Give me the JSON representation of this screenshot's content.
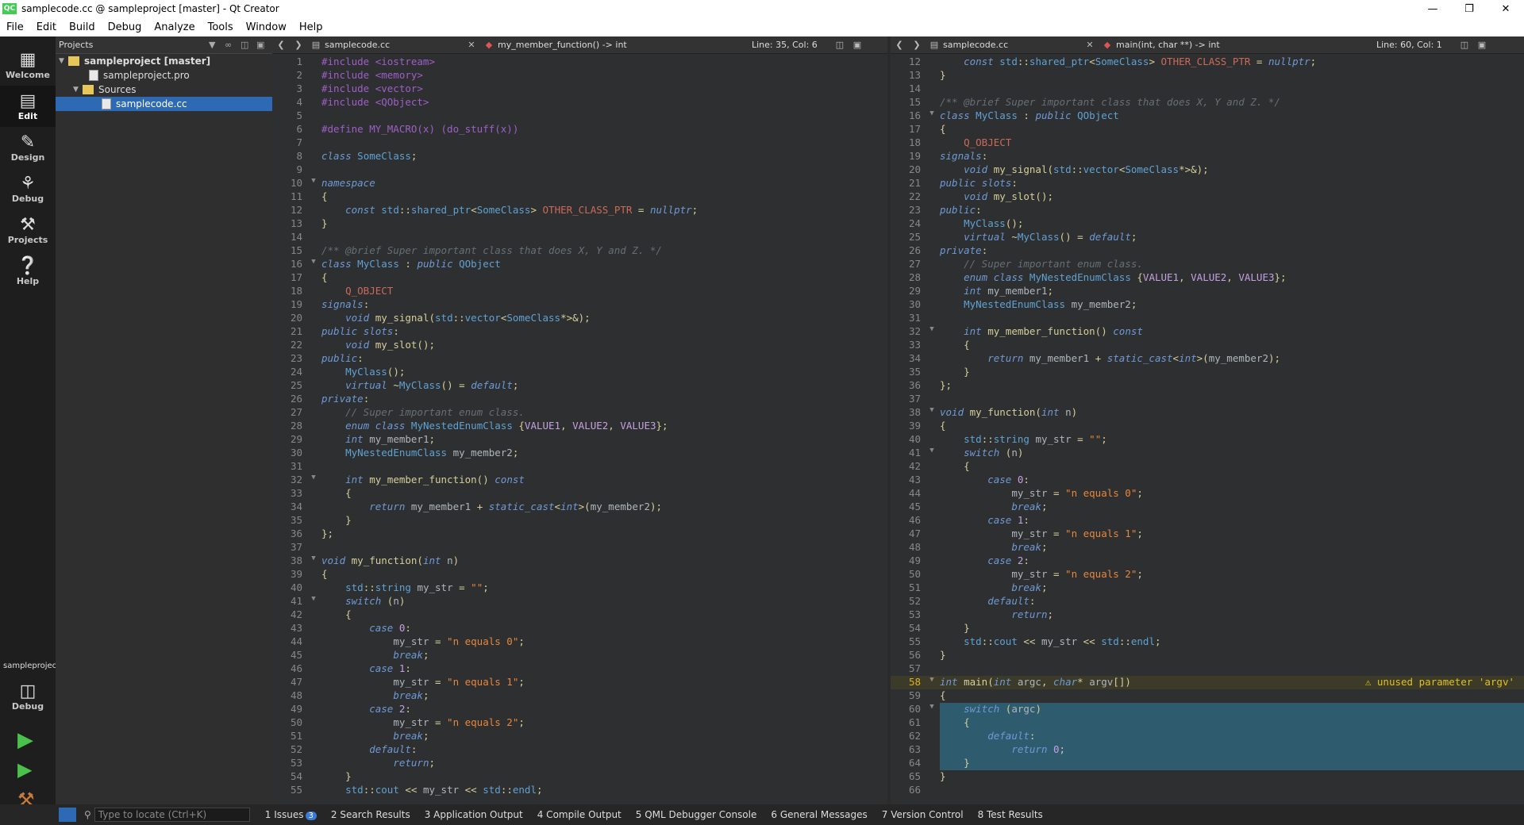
{
  "window": {
    "title": "samplecode.cc @ sampleproject [master] - Qt Creator",
    "logo": "QC"
  },
  "menu": [
    "File",
    "Edit",
    "Build",
    "Debug",
    "Analyze",
    "Tools",
    "Window",
    "Help"
  ],
  "modes": [
    {
      "label": "Welcome",
      "icon": "grid-icon"
    },
    {
      "label": "Edit",
      "icon": "document-icon"
    },
    {
      "label": "Design",
      "icon": "pen-icon"
    },
    {
      "label": "Debug",
      "icon": "bug-icon"
    },
    {
      "label": "Projects",
      "icon": "wrench-icon"
    },
    {
      "label": "Help",
      "icon": "help-icon"
    }
  ],
  "kit": {
    "project": "sampleproject",
    "mode": "Debug"
  },
  "projects": {
    "header": "Projects",
    "tree": [
      "sampleproject [master]",
      "sampleproject.pro",
      "Sources",
      "samplecode.cc"
    ]
  },
  "left_editor": {
    "file": "samplecode.cc",
    "symbol": "my_member_function() -> int",
    "position": "Line: 35, Col: 6"
  },
  "right_editor": {
    "file": "samplecode.cc",
    "symbol": "main(int, char **) -> int",
    "position": "Line: 60, Col: 1",
    "warning": "unused parameter 'argv'"
  },
  "code": [
    "#include <iostream>",
    "#include <memory>",
    "#include <vector>",
    "#include <QObject>",
    "",
    "#define MY_MACRO(x) (do_stuff(x))",
    "",
    "class SomeClass;",
    "",
    "namespace",
    "{",
    "    const std::shared_ptr<SomeClass> OTHER_CLASS_PTR = nullptr;",
    "}",
    "",
    "/** @brief Super important class that does X, Y and Z. */",
    "class MyClass : public QObject",
    "{",
    "    Q_OBJECT",
    "signals:",
    "    void my_signal(std::vector<SomeClass*>&);",
    "public slots:",
    "    void my_slot();",
    "public:",
    "    MyClass();",
    "    virtual ~MyClass() = default;",
    "private:",
    "    // Super important enum class.",
    "    enum class MyNestedEnumClass {VALUE1, VALUE2, VALUE3};",
    "    int my_member1;",
    "    MyNestedEnumClass my_member2;",
    "",
    "    int my_member_function() const",
    "    {",
    "        return my_member1 + static_cast<int>(my_member2);",
    "    }",
    "};",
    "",
    "void my_function(int n)",
    "{",
    "    std::string my_str = \"\";",
    "    switch (n)",
    "    {",
    "        case 0:",
    "            my_str = \"n equals 0\";",
    "            break;",
    "        case 1:",
    "            my_str = \"n equals 1\";",
    "            break;",
    "        case 2:",
    "            my_str = \"n equals 2\";",
    "            break;",
    "        default:",
    "            return;",
    "    }",
    "    std::cout << my_str << std::endl;",
    "}",
    "",
    "int main(int argc, char* argv[])",
    "{",
    "    switch (argc)",
    "    {",
    "        default:",
    "            return 0;",
    "    }",
    "}",
    ""
  ],
  "status": {
    "locate_placeholder": "Type to locate (Ctrl+K)",
    "tabs": [
      "1  Issues",
      "2  Search Results",
      "3  Application Output",
      "4  Compile Output",
      "5  QML Debugger Console",
      "6  General Messages",
      "7  Version Control",
      "8  Test Results"
    ],
    "issues_count": "3"
  }
}
